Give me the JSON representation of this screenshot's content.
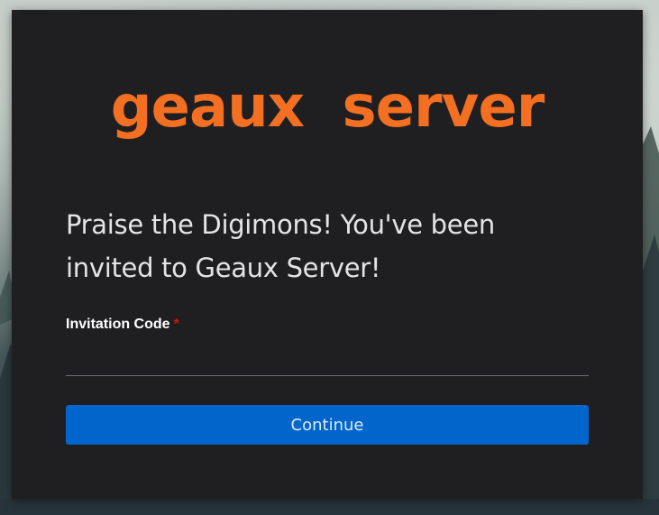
{
  "brand": {
    "logo_text": "geaux  server",
    "logo_color": "#f36f21"
  },
  "main": {
    "heading": "Praise the Digimons! You've been invited to Geaux Server!"
  },
  "form": {
    "invitation_code": {
      "label": "Invitation Code",
      "required_marker": "*",
      "value": ""
    },
    "continue_label": "Continue",
    "button_color": "#0066cc"
  }
}
